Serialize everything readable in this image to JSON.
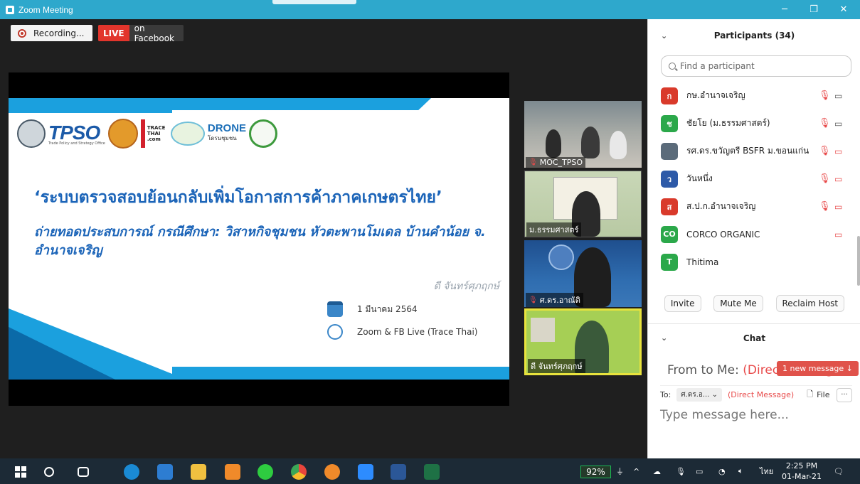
{
  "window": {
    "title": "Zoom Meeting",
    "minimize": "─",
    "maximize": "❐",
    "close": "✕"
  },
  "meeting": {
    "recording_label": "Recording...",
    "live_badge": "LIVE",
    "live_target": "on Facebook"
  },
  "slide": {
    "logos": {
      "tpso": "TPSO",
      "tpso_tagline": "Trade Policy and Strategy Office",
      "trace": "TRACE THAI .com",
      "drone": "DRONE",
      "drone_sub": "โดรนชุมชน"
    },
    "title": "‘ระบบตรวจสอบย้อนกลับเพิ่มโอกาสการค้าภาคเกษตรไทย’",
    "subtitle": "ถ่ายทอดประสบการณ์ กรณีศึกษา: วิสาหกิจชุมชน หัวตะพานโมเดล บ้านคำน้อย จ. อำนาจเจริญ",
    "author": "ดี จันทร์ศุภฤกษ์",
    "date": "1 มีนาคม 2564",
    "venue": "Zoom & FB Live (Trace Thai)"
  },
  "thumbnails": [
    {
      "label": "MOC_TPSO",
      "muted": true
    },
    {
      "label": "ม.ธรรมศาสตร์",
      "muted": false
    },
    {
      "label": "ศ.ดร.อาณัติ",
      "muted": true
    },
    {
      "label": "ดี จันทร์ศุภฤกษ์",
      "muted": false
    }
  ],
  "participants": {
    "header": "Participants (34)",
    "search_placeholder": "Find a participant",
    "items": [
      {
        "initial": "ก",
        "name": "กษ.อำนาจเจริญ",
        "color": "#d93a2b",
        "mic_muted": true,
        "cam_off": false
      },
      {
        "initial": "ช",
        "name": "ชัยโย (ม.ธรรมศาสตร์)",
        "color": "#2ba84a",
        "mic_muted": true,
        "cam_off": false
      },
      {
        "initial": "",
        "name": "รศ.ดร.ขวัญตรี BSFR ม.ขอนแก่น",
        "color": "#5b6b7a",
        "mic_muted": true,
        "cam_off": true
      },
      {
        "initial": "ว",
        "name": "วันหนึ่ง",
        "color": "#2d5aa8",
        "mic_muted": true,
        "cam_off": true
      },
      {
        "initial": "ส",
        "name": "ส.ป.ก.อำนาจเจริญ",
        "color": "#d93a2b",
        "mic_muted": true,
        "cam_off": true
      },
      {
        "initial": "CO",
        "name": "CORCO ORGANIC",
        "color": "#2ba84a",
        "mic_muted": false,
        "cam_off": true
      },
      {
        "initial": "T",
        "name": "Thitima",
        "color": "#2ba84a",
        "mic_muted": false,
        "cam_off": false
      }
    ],
    "buttons": {
      "invite": "Invite",
      "mute_me": "Mute Me",
      "reclaim_host": "Reclaim Host"
    }
  },
  "chat": {
    "header": "Chat",
    "from_prefix": "From  to Me:",
    "from_dm": "(Direct Message)",
    "new_message": "1 new message ↓",
    "to_label": "To:",
    "to_selected": "ศ.ดร.อ...",
    "to_dm": "(Direct Message)",
    "file_label": "File",
    "more": "···",
    "input_placeholder": "Type message here..."
  },
  "taskbar": {
    "battery": "92%",
    "language": "ไทย",
    "time": "2:25 PM",
    "date": "01-Mar-21"
  },
  "colors": {
    "accent": "#2ea8cc",
    "slide_blue": "#1ba0de",
    "live_red": "#e2352c",
    "muted_red": "#e84a4a"
  }
}
